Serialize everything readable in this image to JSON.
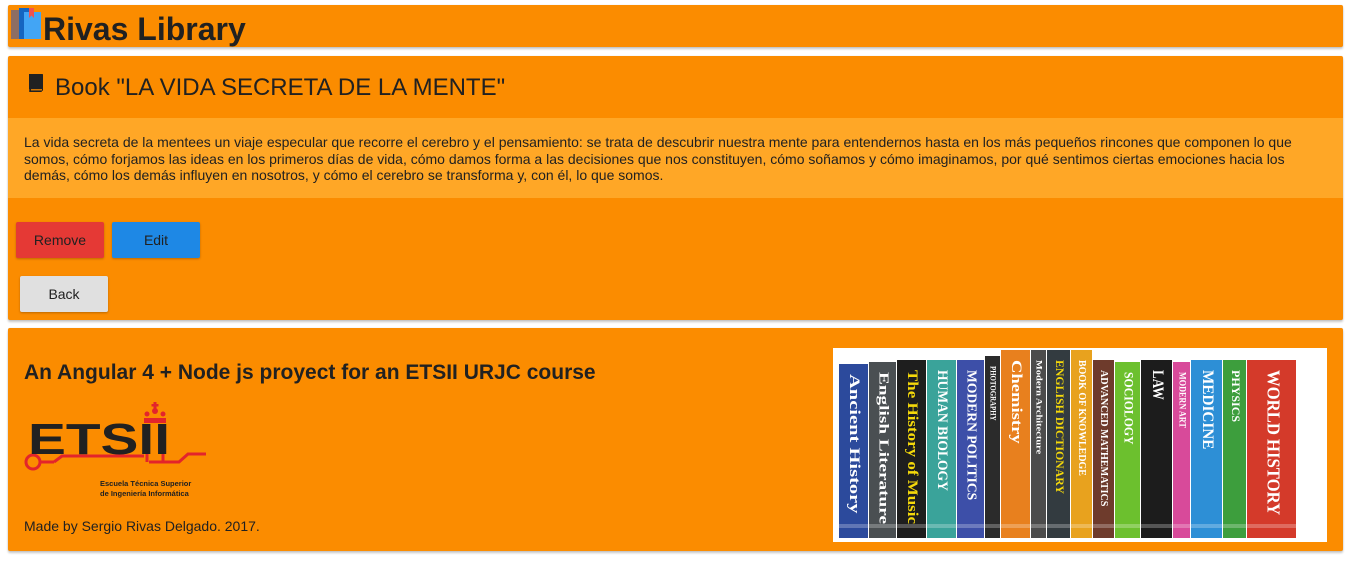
{
  "header": {
    "app_title": "Rivas Library",
    "logo_icon": "books-logo-icon"
  },
  "book": {
    "title": "Book \"LA VIDA SECRETA DE LA MENTE\"",
    "icon": "book-icon",
    "description": "La vida secreta de la mentees un viaje especular que recorre el cerebro y el pensamiento: se trata de descubrir nuestra mente para entendernos hasta en los más pequeños rincones que componen lo que somos, cómo forjamos las ideas en los primeros días de vida, cómo damos forma a las decisiones que nos constituyen, cómo soñamos y cómo imaginamos, por qué sentimos ciertas emociones hacia los demás, cómo los demás influyen en nosotros, y cómo el cerebro se transforma y, con él, lo que somos."
  },
  "actions": {
    "remove_label": "Remove",
    "edit_label": "Edit",
    "back_label": "Back"
  },
  "footer": {
    "tagline": "An Angular 4 + Node js proyect for an ETSII URJC course",
    "credit": "Made by Sergio Rivas Delgado. 2017.",
    "etsii_logo": {
      "wordmark": "ETSII",
      "line1": "Escuela Técnica Superior",
      "line2": "de Ingeniería Informática"
    },
    "shelf_spines": [
      {
        "label": "Ancient History",
        "color": "#2c4a9c",
        "text_color": "#ffffff"
      },
      {
        "label": "English Literature",
        "color": "#4a4f52",
        "text_color": "#ffffff"
      },
      {
        "label": "The History of Music",
        "color": "#1e1e1e",
        "text_color": "#f5d90a"
      },
      {
        "label": "HUMAN BIOLOGY",
        "color": "#3aa39a",
        "text_color": "#ffffff"
      },
      {
        "label": "MODERN POLITICS",
        "color": "#3d4fa8",
        "text_color": "#ffffff"
      },
      {
        "label": "PHOTOGRAPHY",
        "color": "#2b2b2b",
        "text_color": "#ffffff"
      },
      {
        "label": "Chemistry",
        "color": "#e8801e",
        "text_color": "#ffffff"
      },
      {
        "label": "Modern Architecture",
        "color": "#4c4c4c",
        "text_color": "#ffffff"
      },
      {
        "label": "ENGLISH DICTIONARY",
        "color": "#333b40",
        "text_color": "#f5d90a"
      },
      {
        "label": "BOOK OF KNOWLEDGE",
        "color": "#e8a21e",
        "text_color": "#ffffff"
      },
      {
        "label": "ADVANCED MATHEMATICS",
        "color": "#6e3b2c",
        "text_color": "#ffffff"
      },
      {
        "label": "SOCIOLOGY",
        "color": "#6cc02e",
        "text_color": "#ffffff"
      },
      {
        "label": "LAW",
        "color": "#1c1c1c",
        "text_color": "#ffffff"
      },
      {
        "label": "MODERN ART",
        "color": "#d84a9a",
        "text_color": "#ffffff"
      },
      {
        "label": "MEDICINE",
        "color": "#2d8fd6",
        "text_color": "#ffffff"
      },
      {
        "label": "PHYSICS",
        "color": "#3d9e3d",
        "text_color": "#ffffff"
      },
      {
        "label": "WORLD HISTORY",
        "color": "#d43a2a",
        "text_color": "#ffffff"
      }
    ]
  },
  "colors": {
    "primary": "#fb8c00",
    "description_bg": "#ffa726",
    "remove": "#e53935",
    "edit": "#1e88e5",
    "back": "#e0e0e0",
    "etsii_red": "#e3242b"
  }
}
